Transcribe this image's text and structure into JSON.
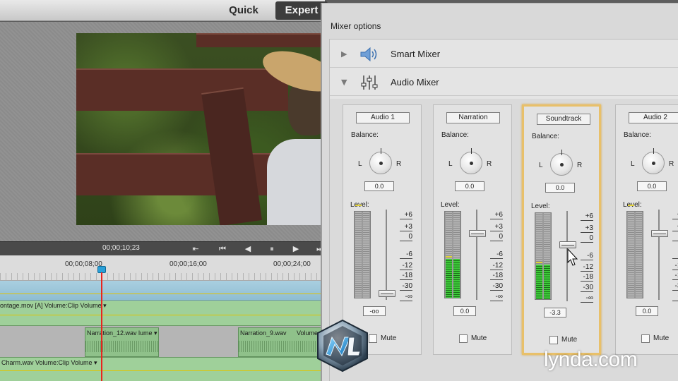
{
  "editor": {
    "modes": {
      "quick": "Quick",
      "expert": "Expert"
    },
    "transport": {
      "timecode": "00;00;10;23"
    },
    "ruler": {
      "ticks": [
        "00;00;08;00",
        "00;00;16;00",
        "00;00;24;00"
      ]
    },
    "tracks": {
      "video_clip_label": "ontage.mov [A] Volume:Clip Volume ▾",
      "narration_clip1": "Narration_12.wav",
      "narration_clip1_suffix": "lume ▾",
      "narration_clip2": "Narration_9.wav",
      "narration_clip2_suffix": "Volume ▾",
      "music_clip_label": "Charm.wav   Volume:Clip Volume ▾"
    }
  },
  "mixer": {
    "title": "Mixer options",
    "sections": [
      {
        "label": "Smart Mixer",
        "icon": "speaker-icon",
        "expanded": false
      },
      {
        "label": "Audio Mixer",
        "icon": "mixer-sliders-icon",
        "expanded": true
      }
    ],
    "balance_label": "Balance:",
    "level_label": "Level:",
    "left_label": "L",
    "right_label": "R",
    "mute_label": "Mute",
    "scale_marks": [
      "+6",
      "+3",
      "0",
      "-6",
      "-12",
      "-18",
      "-30",
      "-∞"
    ],
    "channels": [
      {
        "name": "Audio 1",
        "balance": "0.0",
        "level": "-oo",
        "fader_db": "-∞",
        "meter_fill": 0.0,
        "selected": false,
        "muted": false
      },
      {
        "name": "Narration",
        "balance": "0.0",
        "level": "0.0",
        "fader_db": "0",
        "meter_fill": 0.45,
        "selected": false,
        "muted": false
      },
      {
        "name": "Soundtrack",
        "balance": "0.0",
        "level": "-3.3",
        "fader_db": "-3.3",
        "meter_fill": 0.4,
        "selected": true,
        "muted": false
      },
      {
        "name": "Audio 2",
        "balance": "0.0",
        "level": "0.0",
        "fader_db": "0",
        "meter_fill": 0.0,
        "selected": false,
        "muted": false
      }
    ]
  },
  "watermark": {
    "text": "lynda.com"
  },
  "colors": {
    "selected_border": "#e8c06a",
    "meter_green": "#3ecb3a",
    "playhead": "#e8241e",
    "audio_track": "#9fd09a"
  }
}
